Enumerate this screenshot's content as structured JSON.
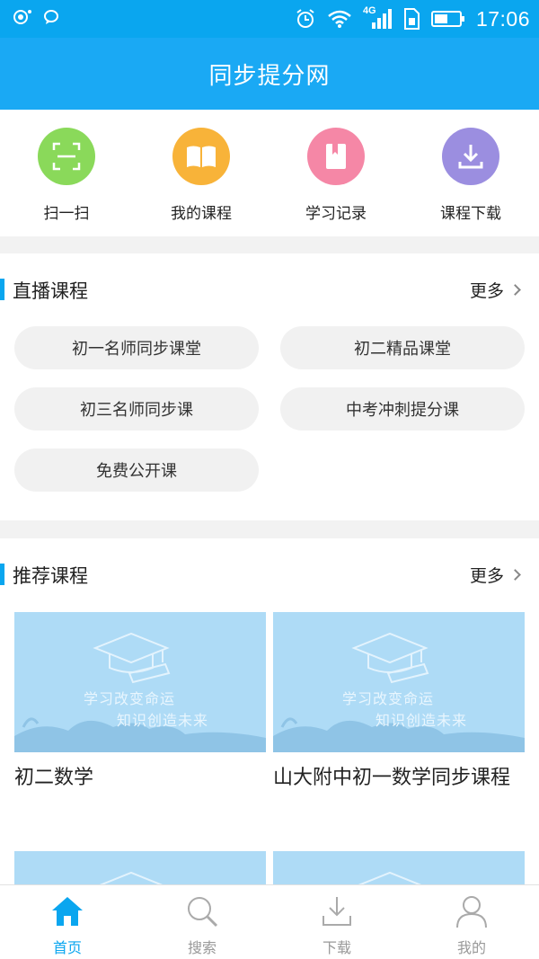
{
  "status_bar": {
    "network_label": "4G",
    "time": "17:06"
  },
  "header": {
    "title": "同步提分网"
  },
  "quick_actions": [
    {
      "label": "扫一扫",
      "icon": "scan-icon",
      "color": "#8ad95a"
    },
    {
      "label": "我的课程",
      "icon": "book-icon",
      "color": "#f8b339"
    },
    {
      "label": "学习记录",
      "icon": "bookmark-icon",
      "color": "#f587a6"
    },
    {
      "label": "课程下载",
      "icon": "download-icon",
      "color": "#9b8ee0"
    }
  ],
  "live_courses": {
    "title": "直播课程",
    "more_label": "更多",
    "items": [
      "初一名师同步课堂",
      "初二精品课堂",
      "初三名师同步课",
      "中考冲刺提分课",
      "免费公开课"
    ]
  },
  "recommended": {
    "title": "推荐课程",
    "more_label": "更多",
    "cards": [
      {
        "title": "初二数学",
        "slogan_line1": "学习改变命运",
        "slogan_line2": "知识创造未来"
      },
      {
        "title": "山大附中初一数学同步课程",
        "slogan_line1": "学习改变命运",
        "slogan_line2": "知识创造未来"
      }
    ]
  },
  "tab_bar": {
    "active_color": "#0aa6ef",
    "items": [
      {
        "label": "首页",
        "icon": "home-icon",
        "active": true
      },
      {
        "label": "搜索",
        "icon": "search-icon",
        "active": false
      },
      {
        "label": "下载",
        "icon": "download-icon",
        "active": false
      },
      {
        "label": "我的",
        "icon": "user-icon",
        "active": false
      }
    ]
  }
}
